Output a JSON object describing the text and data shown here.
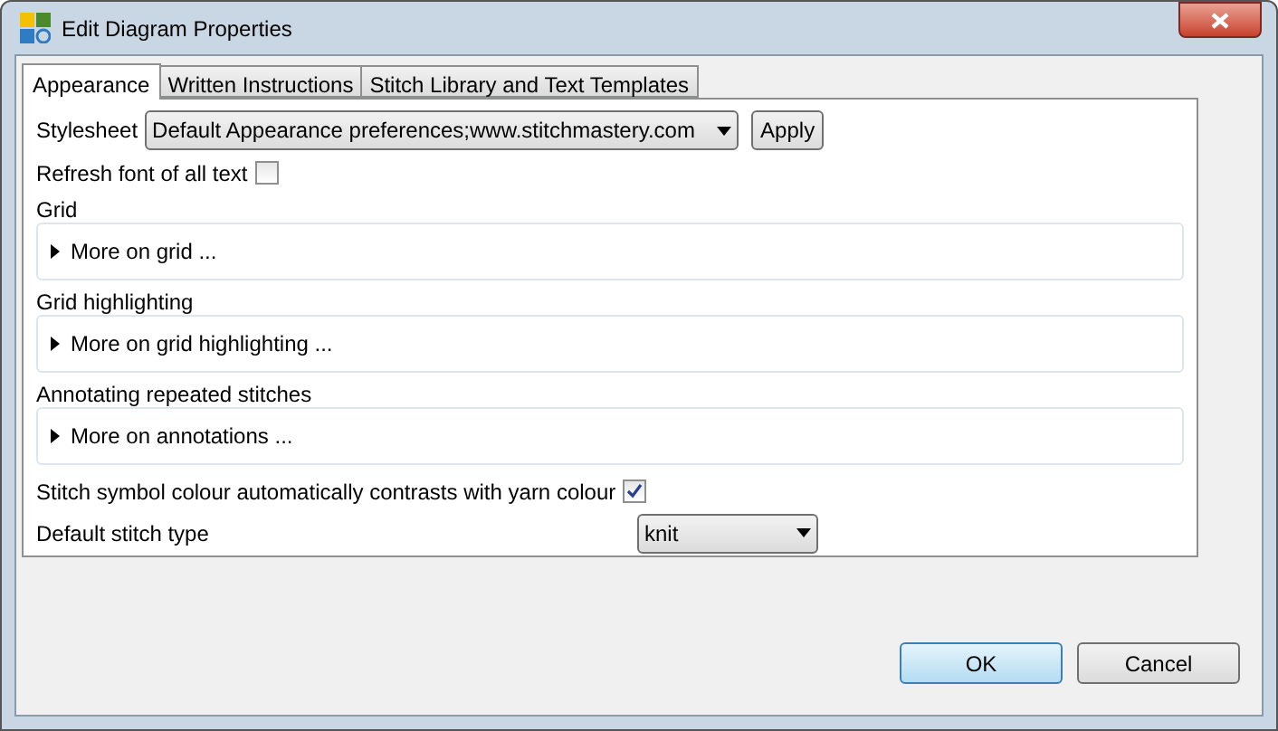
{
  "window": {
    "title": "Edit Diagram Properties"
  },
  "tabs": [
    {
      "label": "Appearance",
      "selected": true
    },
    {
      "label": "Written Instructions",
      "selected": false
    },
    {
      "label": "Stitch Library and Text Templates",
      "selected": false
    }
  ],
  "stylesheet": {
    "label": "Stylesheet",
    "value": "Default Appearance preferences;www.stitchmastery.com",
    "apply": "Apply"
  },
  "refresh_font": {
    "label": "Refresh font of all text",
    "checked": false
  },
  "groups": [
    {
      "title": "Grid",
      "toggle": "More on grid ...",
      "expanded": false
    },
    {
      "title": "Grid highlighting",
      "toggle": "More on grid highlighting ...",
      "expanded": false
    },
    {
      "title": "Annotating repeated stitches",
      "toggle": "More on annotations ...",
      "expanded": false
    }
  ],
  "contrast": {
    "label": "Stitch symbol colour automatically contrasts with yarn colour",
    "checked": true
  },
  "stitch_type": {
    "label": "Default stitch type",
    "value": "knit"
  },
  "buttons": [
    {
      "label": "OK",
      "default": true
    },
    {
      "label": "Cancel",
      "default": false
    }
  ]
}
